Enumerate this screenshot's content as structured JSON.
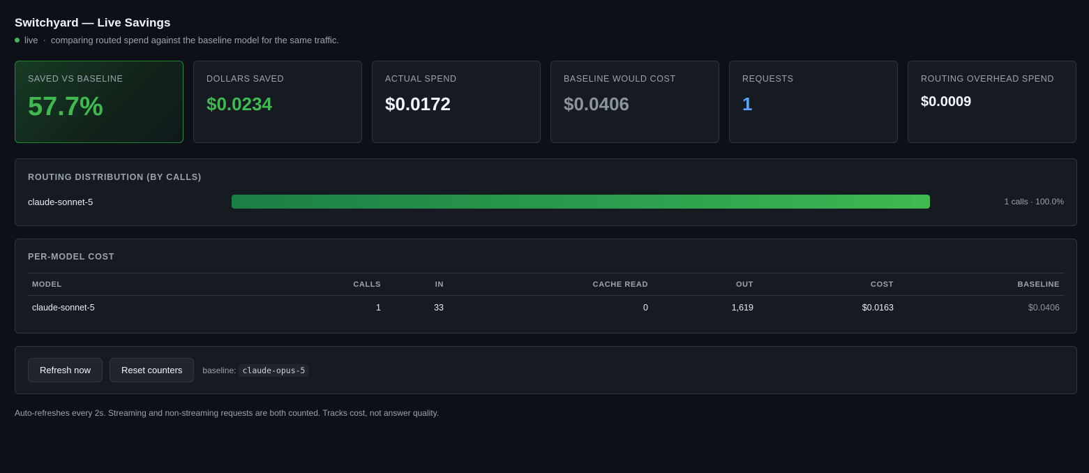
{
  "header": {
    "title": "Switchyard — Live Savings",
    "status": "live",
    "separator": "·",
    "description": "comparing routed spend against the baseline model for the same traffic."
  },
  "cards": [
    {
      "label": "SAVED VS BASELINE",
      "value": "57.7%"
    },
    {
      "label": "DOLLARS SAVED",
      "value": "$0.0234"
    },
    {
      "label": "ACTUAL SPEND",
      "value": "$0.0172"
    },
    {
      "label": "BASELINE WOULD COST",
      "value": "$0.0406"
    },
    {
      "label": "REQUESTS",
      "value": "1"
    },
    {
      "label": "ROUTING OVERHEAD SPEND",
      "value": "$0.0009"
    }
  ],
  "routing": {
    "title": "ROUTING DISTRIBUTION (BY CALLS)",
    "rows": [
      {
        "model": "claude-sonnet-5",
        "fraction": 1.0,
        "stat": "1 calls · 100.0%"
      }
    ]
  },
  "per_model": {
    "title": "PER-MODEL COST",
    "columns": [
      "MODEL",
      "CALLS",
      "IN",
      "CACHE READ",
      "OUT",
      "COST",
      "BASELINE"
    ],
    "rows": [
      {
        "model": "claude-sonnet-5",
        "calls": "1",
        "in": "33",
        "cache_read": "0",
        "out": "1,619",
        "cost": "$0.0163",
        "baseline": "$0.0406"
      }
    ]
  },
  "actions": {
    "refresh_label": "Refresh now",
    "reset_label": "Reset counters",
    "baseline_label": "baseline:",
    "baseline_model": "claude-opus-5"
  },
  "footer": "Auto-refreshes every 2s. Streaming and non-streaming requests are both counted. Tracks cost, not answer quality.",
  "colors": {
    "accent_green": "#3fb950",
    "accent_blue": "#58a6ff",
    "background": "#0d1117",
    "panel": "#161b22"
  }
}
